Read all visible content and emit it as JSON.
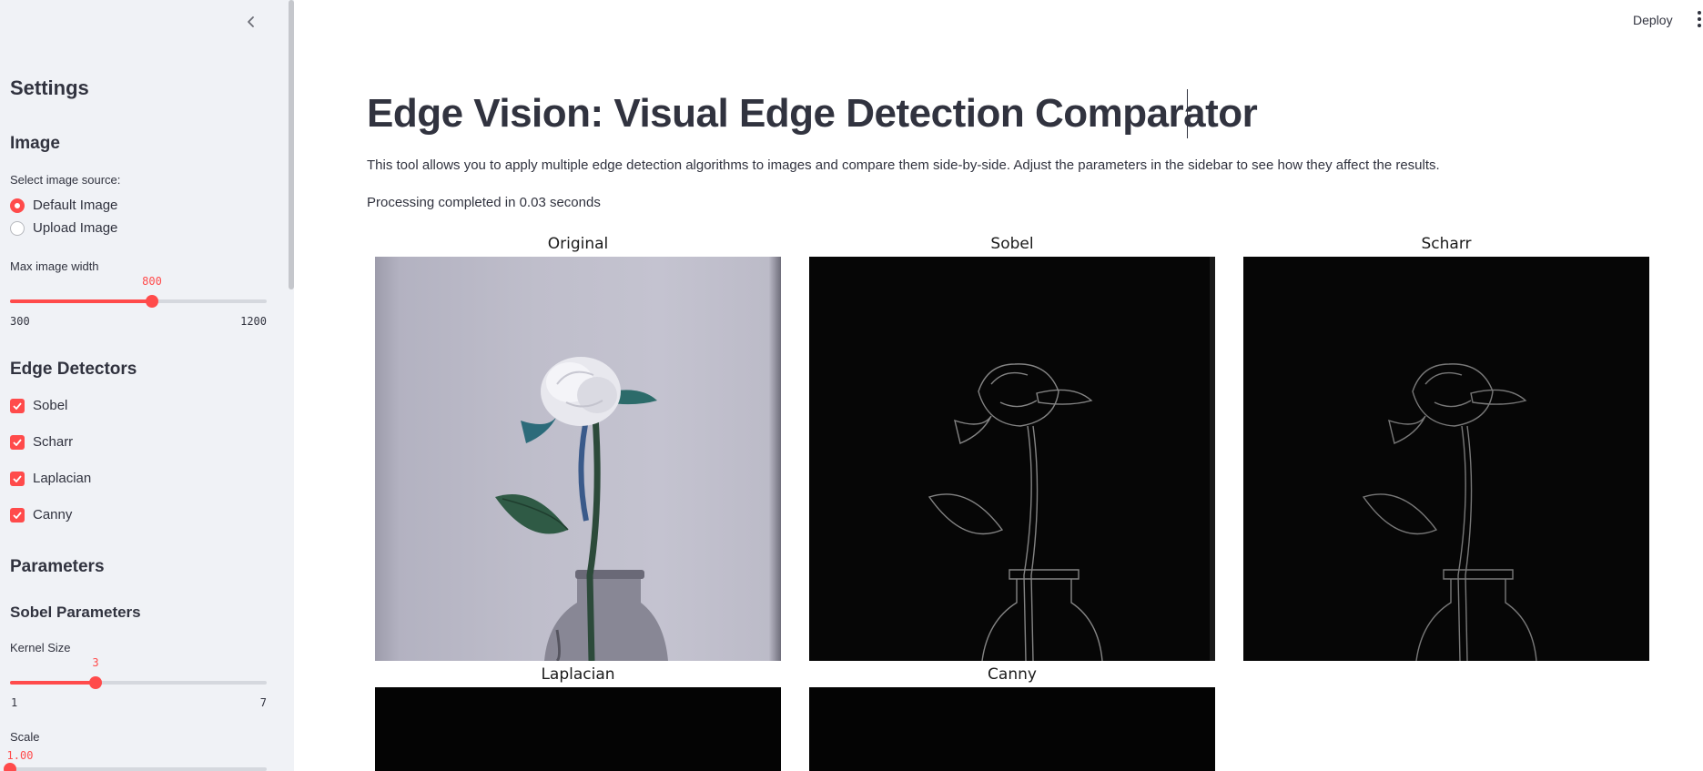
{
  "sidebar": {
    "title": "Settings",
    "image_section": {
      "heading": "Image",
      "source_label": "Select image source:",
      "options": [
        "Default Image",
        "Upload Image"
      ],
      "selected_option": "Default Image",
      "max_width": {
        "label": "Max image width",
        "value": "800",
        "min": "300",
        "max": "1200"
      }
    },
    "detectors": {
      "heading": "Edge Detectors",
      "items": [
        "Sobel",
        "Scharr",
        "Laplacian",
        "Canny"
      ],
      "checked": [
        true,
        true,
        true,
        true
      ]
    },
    "parameters": {
      "heading": "Parameters",
      "sobel_heading": "Sobel Parameters",
      "kernel": {
        "label": "Kernel Size",
        "value": "3",
        "min": "1",
        "max": "7"
      },
      "scale": {
        "label": "Scale",
        "value": "1.00"
      }
    }
  },
  "header": {
    "deploy_label": "Deploy"
  },
  "main": {
    "title": "Edge Vision: Visual Edge Detection Comparator",
    "description": "This tool allows you to apply multiple edge detection algorithms to images and compare them side-by-side. Adjust the parameters in the sidebar to see how they affect the results.",
    "status": "Processing completed in 0.03 seconds",
    "panels": [
      "Original",
      "Sobel",
      "Scharr",
      "Laplacian",
      "Canny"
    ]
  },
  "colors": {
    "accent": "#ff4b4b",
    "sidebar_bg": "#f0f2f6",
    "text": "#31333f"
  }
}
